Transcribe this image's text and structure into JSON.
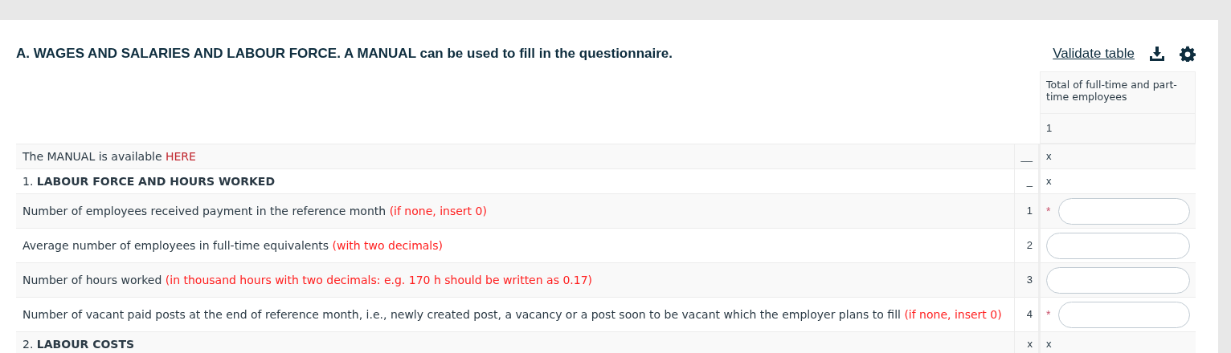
{
  "title": "A. WAGES AND SALARIES AND LABOUR FORCE. A MANUAL can be used to fill in the questionnaire.",
  "toolbar": {
    "validate_link": "Validate table"
  },
  "table": {
    "column_header": "Total of full-time and part-time employees",
    "column_number": "1",
    "rows": [
      {
        "kind": "info",
        "text": "The MANUAL is available ",
        "link": "HERE",
        "code": "__",
        "value": "x"
      },
      {
        "kind": "section",
        "text": "1. **LABOUR FORCE AND HOURS WORKED**",
        "code": "_",
        "value": "x"
      },
      {
        "kind": "input",
        "text": "Number of employees received payment in the reference month ",
        "note": "(if none, insert 0)",
        "code": "1",
        "marker": "*"
      },
      {
        "kind": "input",
        "text": "Average number of employees in full-time equivalents ",
        "note": "(with two decimals)",
        "code": "2"
      },
      {
        "kind": "input",
        "text": "Number of hours worked ",
        "note": "(in thousand hours with two decimals: e.g. 170 h should be written as 0.17)",
        "code": "3"
      },
      {
        "kind": "input",
        "text": "Number of vacant paid posts at the end of reference month, i.e., newly created post, a vacancy or a post soon to be vacant which the employer plans to fill ",
        "note": "(if none, insert 0)",
        "code": "4",
        "marker": "*"
      },
      {
        "kind": "section",
        "text": "2. **LABOUR COSTS**",
        "code": "x",
        "value": "x"
      }
    ]
  }
}
